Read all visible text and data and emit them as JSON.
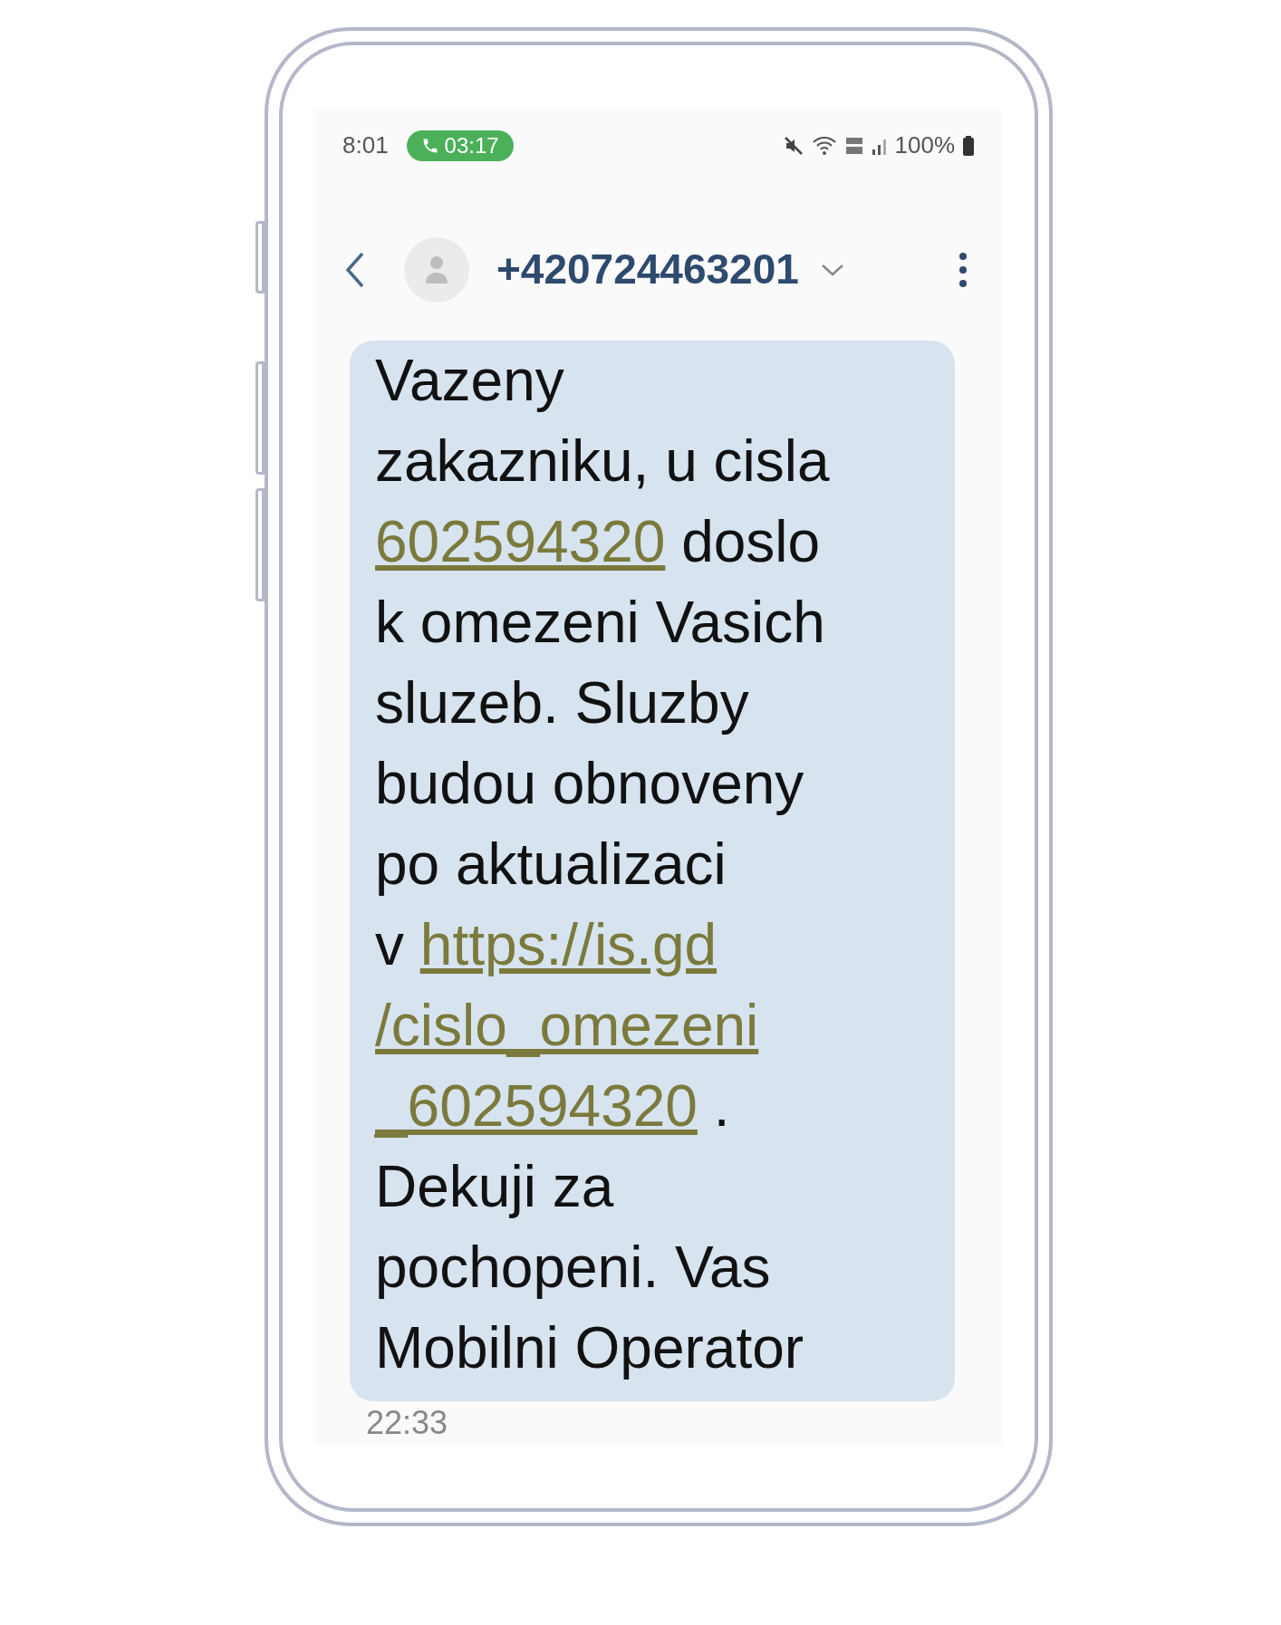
{
  "status_bar": {
    "time": "8:01",
    "call_timer": "03:17",
    "battery": "100%"
  },
  "header": {
    "contact": "+420724463201"
  },
  "message": {
    "lines": [
      [
        {
          "kind": "text",
          "text": "Vazeny"
        }
      ],
      [
        {
          "kind": "text",
          "text": "zakazniku, u cisla"
        }
      ],
      [
        {
          "kind": "link",
          "text": "602594320"
        },
        {
          "kind": "text",
          "text": " doslo"
        }
      ],
      [
        {
          "kind": "text",
          "text": "k omezeni Vasich"
        }
      ],
      [
        {
          "kind": "text",
          "text": "sluzeb. Sluzby"
        }
      ],
      [
        {
          "kind": "text",
          "text": "budou obnoveny"
        }
      ],
      [
        {
          "kind": "text",
          "text": "po aktualizaci"
        }
      ],
      [
        {
          "kind": "text",
          "text": "v "
        },
        {
          "kind": "link",
          "text": "https://is.gd"
        }
      ],
      [
        {
          "kind": "link",
          "text": "/cislo_omezeni"
        }
      ],
      [
        {
          "kind": "link",
          "text": "_602594320"
        },
        {
          "kind": "text",
          "text": " ."
        }
      ],
      [
        {
          "kind": "text",
          "text": "Dekuji za"
        }
      ],
      [
        {
          "kind": "text",
          "text": "pochopeni. Vas"
        }
      ],
      [
        {
          "kind": "text",
          "text": "Mobilni Operator"
        }
      ]
    ],
    "time": "22:33"
  }
}
